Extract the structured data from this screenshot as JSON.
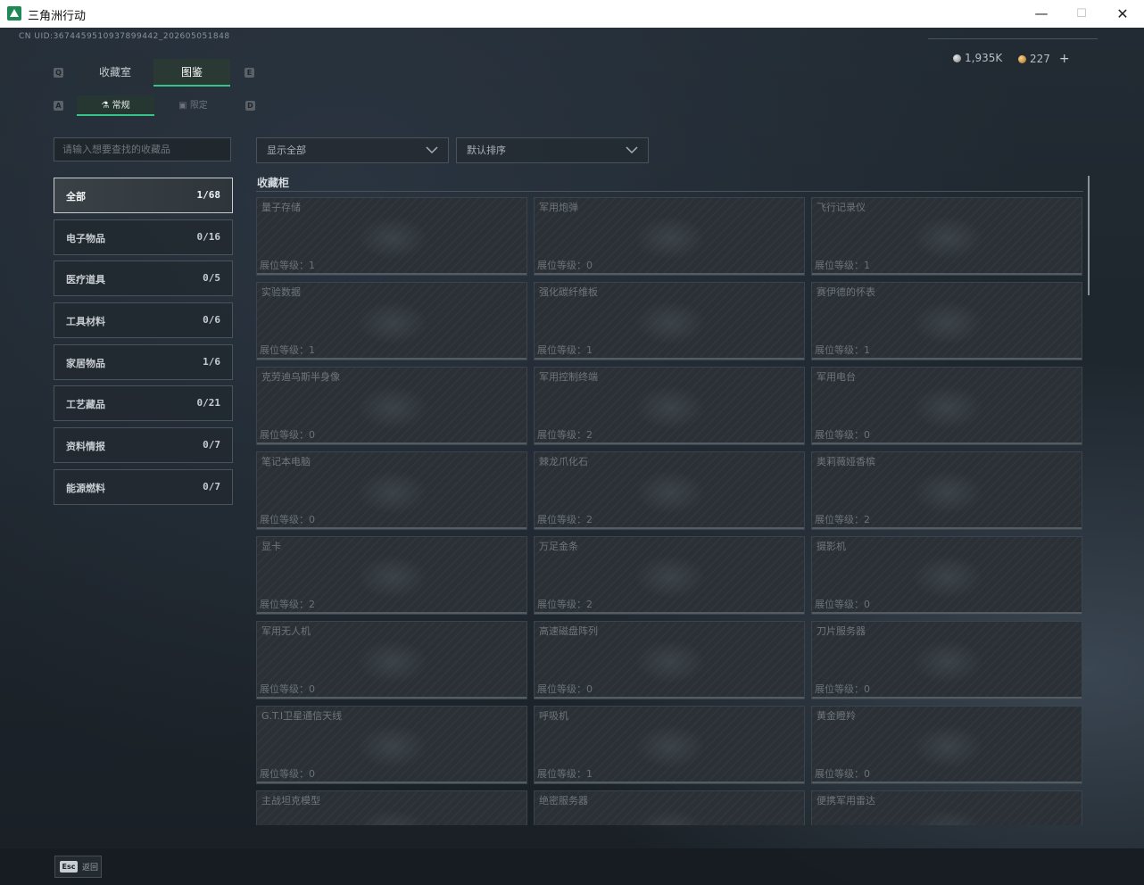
{
  "window": {
    "title": "三角洲行动",
    "controls": {
      "minimize": "—",
      "maximize": "☐",
      "close": "✕"
    }
  },
  "header": {
    "uid": "CN UID:3674459510937899442_202605051848",
    "currency": [
      {
        "icon": "silver-coin-icon",
        "value": "1,935K"
      },
      {
        "icon": "gold-coin-icon",
        "value": "227",
        "add": "+"
      }
    ]
  },
  "tabs_primary": [
    {
      "label": "收藏室",
      "active": false
    },
    {
      "label": "图鉴",
      "active": true
    }
  ],
  "tabs_primary_keys": [
    "Q",
    "E"
  ],
  "tabs_secondary": [
    {
      "label": "常规",
      "icon": "flask-icon",
      "active": true
    },
    {
      "label": "限定",
      "icon": "box-icon",
      "active": false
    }
  ],
  "tabs_secondary_keys": [
    "A",
    "D"
  ],
  "search": {
    "placeholder": "请输入想要查找的收藏品"
  },
  "categories": [
    {
      "name": "全部",
      "count": "1/68",
      "active": true
    },
    {
      "name": "电子物品",
      "count": "0/16"
    },
    {
      "name": "医疗道具",
      "count": "0/5"
    },
    {
      "name": "工具材料",
      "count": "0/6"
    },
    {
      "name": "家居物品",
      "count": "1/6"
    },
    {
      "name": "工艺藏品",
      "count": "0/21"
    },
    {
      "name": "资料情报",
      "count": "0/7"
    },
    {
      "name": "能源燃料",
      "count": "0/7"
    }
  ],
  "filters": {
    "display": "显示全部",
    "sort": "默认排序"
  },
  "section_title": "收藏柜",
  "items": [
    {
      "name": "量子存储",
      "level": "展位等级：1"
    },
    {
      "name": "军用炮弹",
      "level": "展位等级：0"
    },
    {
      "name": "飞行记录仪",
      "level": "展位等级：1"
    },
    {
      "name": "实验数据",
      "level": "展位等级：1"
    },
    {
      "name": "强化碳纤维板",
      "level": "展位等级：1"
    },
    {
      "name": "赛伊德的怀表",
      "level": "展位等级：1"
    },
    {
      "name": "克劳迪乌斯半身像",
      "level": "展位等级：0"
    },
    {
      "name": "军用控制终端",
      "level": "展位等级：2"
    },
    {
      "name": "军用电台",
      "level": "展位等级：0"
    },
    {
      "name": "笔记本电脑",
      "level": "展位等级：0"
    },
    {
      "name": "棘龙爪化石",
      "level": "展位等级：2"
    },
    {
      "name": "奥莉薇娅香槟",
      "level": "展位等级：2"
    },
    {
      "name": "显卡",
      "level": "展位等级：2"
    },
    {
      "name": "万足金条",
      "level": "展位等级：2"
    },
    {
      "name": "摄影机",
      "level": "展位等级：0"
    },
    {
      "name": "军用无人机",
      "level": "展位等级：0"
    },
    {
      "name": "高速磁盘阵列",
      "level": "展位等级：0"
    },
    {
      "name": "刀片服务器",
      "level": "展位等级：0"
    },
    {
      "name": "G.T.I卫星通信天线",
      "level": "展位等级：0"
    },
    {
      "name": "呼吸机",
      "level": "展位等级：1"
    },
    {
      "name": "黄金瞪羚",
      "level": "展位等级：0"
    },
    {
      "name": "主战坦克模型",
      "level": ""
    },
    {
      "name": "绝密服务器",
      "level": ""
    },
    {
      "name": "便携军用雷达",
      "level": ""
    }
  ],
  "footer": {
    "key": "Esc",
    "label": "返回"
  }
}
